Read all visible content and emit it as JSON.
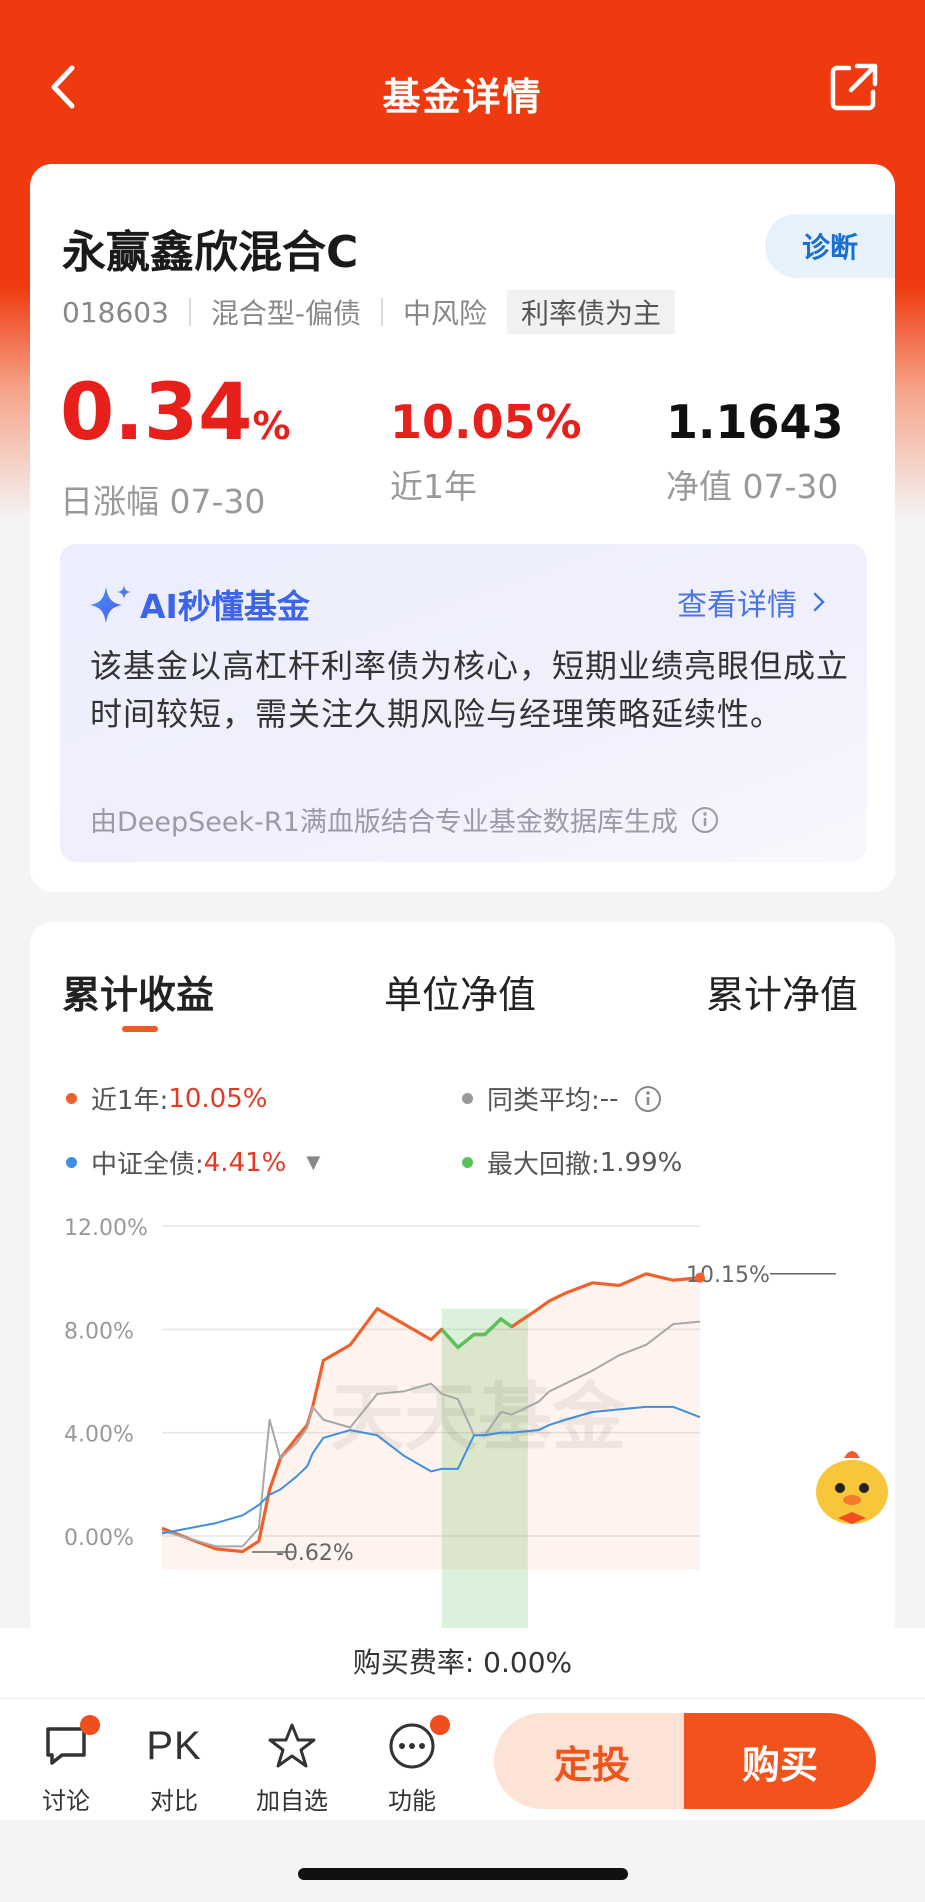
{
  "header": {
    "title": "基金详情",
    "back_icon": "chevron-left-icon",
    "share_icon": "share-icon"
  },
  "fund": {
    "name": "永赢鑫欣混合C",
    "diagnose_label": "诊断",
    "code": "018603",
    "type": "混合型-偏债",
    "risk": "中风险",
    "tag": "利率债为主",
    "daily_change_value": "0.34",
    "daily_change_unit": "%",
    "daily_change_label": "日涨幅 07-30",
    "year_return": "10.05%",
    "year_return_label": "近1年",
    "nav": "1.1643",
    "nav_label": "净值 07-30"
  },
  "ai": {
    "title": "AI秒懂基金",
    "more_label": "查看详情",
    "summary": "该基金以高杠杆利率债为核心，短期业绩亮眼但成立时间较短，需关注久期风险与经理策略延续性。",
    "note": "由DeepSeek-R1满血版结合专业基金数据库生成"
  },
  "chart_tabs": [
    "累计收益",
    "单位净值",
    "累计净值"
  ],
  "legend": {
    "fund_label": "近1年:",
    "fund_value": "10.05%",
    "peer_label": "同类平均:",
    "peer_value": "--",
    "index_label": "中证全债:",
    "index_value": "4.41%",
    "drawdown_label": "最大回撤:",
    "drawdown_value": "1.99%"
  },
  "colors": {
    "brand": "#ee3a0e",
    "fund_line": "#f0602a",
    "peer_line": "#a8a8a8",
    "index_line": "#3f8fe0",
    "drawdown": "#5cc15a",
    "up": "#e8201b"
  },
  "chart_data": {
    "type": "line",
    "ylim": [
      -1,
      12
    ],
    "y_ticks": [
      "12.00%",
      "8.00%",
      "4.00%",
      "0.00%"
    ],
    "y_tick_values": [
      12,
      8,
      4,
      0
    ],
    "x": [
      0,
      5,
      10,
      15,
      18,
      20,
      22,
      25,
      27,
      28,
      30,
      35,
      40,
      45,
      50,
      52,
      55,
      58,
      60,
      63,
      65,
      70,
      72,
      75,
      80,
      85,
      90,
      95,
      100
    ],
    "series": [
      {
        "name": "近1年",
        "values": [
          0.3,
          -0.1,
          -0.5,
          -0.6,
          -0.2,
          1.8,
          3.0,
          3.8,
          4.3,
          5.0,
          6.8,
          7.4,
          8.8,
          8.2,
          7.6,
          8.0,
          7.3,
          7.8,
          7.8,
          8.4,
          8.1,
          8.8,
          9.1,
          9.4,
          9.8,
          9.7,
          10.15,
          9.9,
          10.0
        ]
      },
      {
        "name": "同类平均",
        "values": [
          0.2,
          -0.1,
          -0.4,
          -0.4,
          0.3,
          4.5,
          3.0,
          3.6,
          4.2,
          5.0,
          4.5,
          4.2,
          5.5,
          5.6,
          5.9,
          5.5,
          5.3,
          3.9,
          3.9,
          4.8,
          4.7,
          5.2,
          5.6,
          5.9,
          6.4,
          7.0,
          7.4,
          8.2,
          8.3
        ]
      },
      {
        "name": "中证全债",
        "values": [
          0.1,
          0.3,
          0.5,
          0.8,
          1.2,
          1.6,
          1.8,
          2.3,
          2.7,
          3.2,
          3.8,
          4.1,
          3.9,
          3.1,
          2.5,
          2.6,
          2.6,
          3.9,
          3.9,
          4.0,
          4.0,
          4.1,
          4.3,
          4.5,
          4.8,
          4.9,
          5.0,
          5.0,
          4.6
        ]
      }
    ],
    "drawdown_range": [
      52,
      68
    ],
    "annotations": [
      "10.15%",
      "-0.62%"
    ],
    "watermark": "天天基金"
  },
  "fee": "购买费率: 0.00%",
  "bottom_nav": {
    "discuss": "讨论",
    "compare_icon_text": "PK",
    "compare": "对比",
    "watchlist": "加自选",
    "functions": "功能",
    "auto_invest": "定投",
    "buy": "购买"
  }
}
